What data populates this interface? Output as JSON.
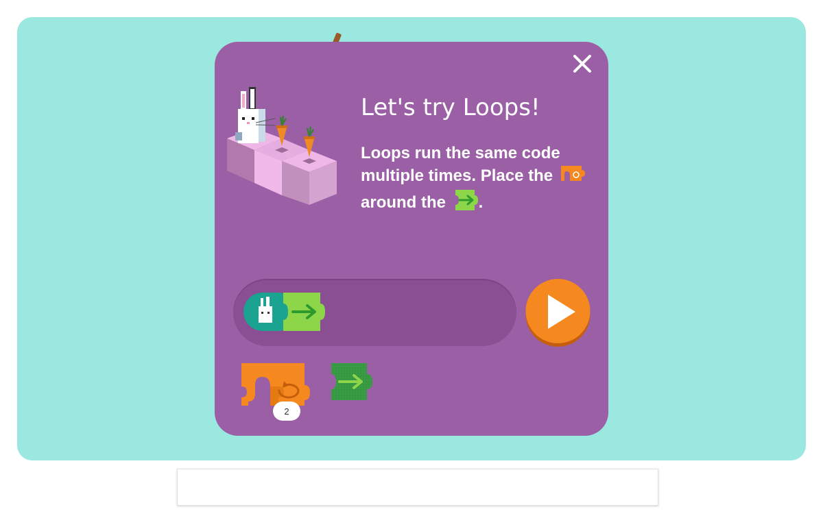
{
  "modal": {
    "title": "Let's try Loops!",
    "text_part1": "Loops run the same code multiple times. Place the",
    "text_part2": "around the",
    "text_end": ".",
    "close_icon": "close-icon"
  },
  "palette": {
    "loop_block": {
      "icon": "repeat-icon",
      "count": "2"
    },
    "move_block": {
      "icon": "arrow-right-icon"
    }
  },
  "program": {
    "start_block": {
      "icon": "bunny-icon"
    },
    "move_block": {
      "icon": "arrow-right-icon"
    }
  },
  "colors": {
    "stage": "#9ae8df",
    "modal": "#9b5fa5",
    "track": "#8a4f93",
    "play": "#f5891f",
    "loop_block": "#f5891f",
    "move_block": "#8dd64a",
    "start_block": "#1aa391"
  }
}
